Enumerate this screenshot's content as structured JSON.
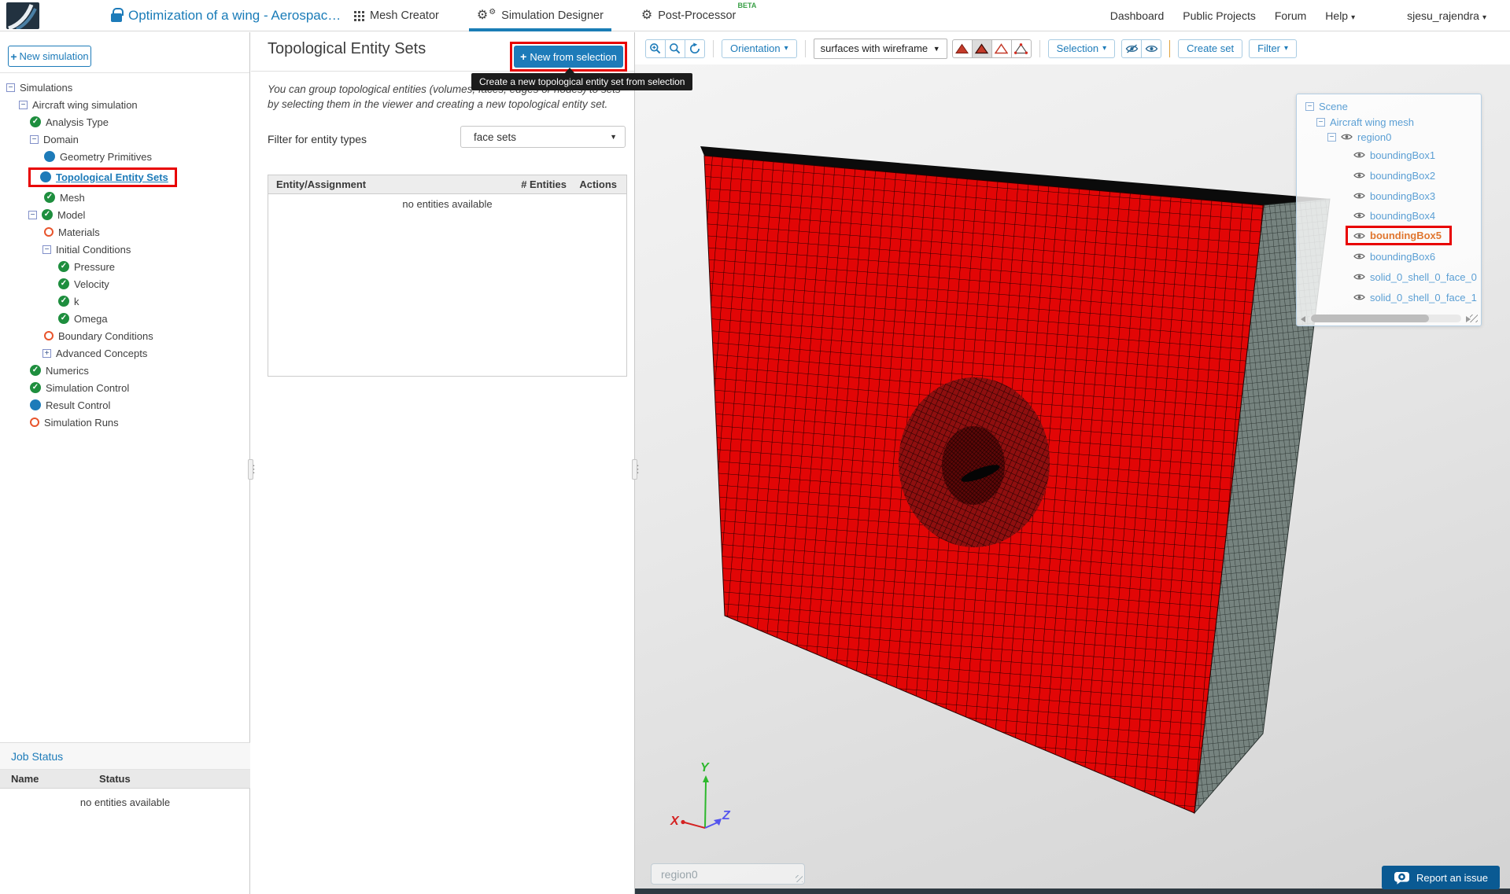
{
  "topbar": {
    "title": "Optimization of a wing - Aerospac…",
    "tabs": [
      {
        "label": "Mesh Creator"
      },
      {
        "label": "Simulation Designer"
      },
      {
        "label": "Post-Processor",
        "badge": "BETA"
      }
    ],
    "nav": [
      "Dashboard",
      "Public Projects",
      "Forum"
    ],
    "help": "Help",
    "user": "sjesu_rajendra"
  },
  "sidebar": {
    "new_simulation": "New simulation",
    "tree": [
      {
        "label": "Simulations"
      },
      {
        "label": "Aircraft wing simulation"
      },
      {
        "label": "Analysis Type"
      },
      {
        "label": "Domain"
      },
      {
        "label": "Geometry Primitives"
      },
      {
        "label": "Topological Entity Sets"
      },
      {
        "label": "Mesh"
      },
      {
        "label": "Model"
      },
      {
        "label": "Materials"
      },
      {
        "label": "Initial Conditions"
      },
      {
        "label": "Pressure"
      },
      {
        "label": "Velocity"
      },
      {
        "label": "k"
      },
      {
        "label": "Omega"
      },
      {
        "label": "Boundary Conditions"
      },
      {
        "label": "Advanced Concepts"
      },
      {
        "label": "Numerics"
      },
      {
        "label": "Simulation Control"
      },
      {
        "label": "Result Control"
      },
      {
        "label": "Simulation Runs"
      }
    ],
    "job_status": {
      "title": "Job Status",
      "col_name": "Name",
      "col_status": "Status",
      "empty": "no entities available"
    }
  },
  "panel": {
    "title": "Topological Entity Sets",
    "new_from_selection": "New from selection",
    "tooltip": "Create a new topological entity set from selection",
    "description": "You can group topological entities (volumes, faces, edges or nodes) to sets by selecting them in the viewer and creating a new topological entity set.",
    "filter_label": "Filter for entity types",
    "filter_value": "face sets",
    "table": {
      "col_entity": "Entity/Assignment",
      "col_count": "# Entities",
      "col_actions": "Actions",
      "empty": "no entities available"
    }
  },
  "viewer": {
    "toolbar": {
      "orientation": "Orientation",
      "render_mode": "surfaces with wireframe",
      "selection": "Selection",
      "create_set": "Create set",
      "filter": "Filter"
    },
    "scene": [
      "Scene",
      "Aircraft wing mesh",
      "region0",
      "boundingBox1",
      "boundingBox2",
      "boundingBox3",
      "boundingBox4",
      "boundingBox5",
      "boundingBox6",
      "solid_0_shell_0_face_0",
      "solid_0_shell_0_face_1"
    ],
    "region_label": "region0",
    "axes": {
      "x": "X",
      "y": "Y",
      "z": "Z"
    },
    "report": "Report an issue"
  },
  "colors": {
    "accent": "#1d7bb9",
    "highlight_box": "#e80000",
    "status_done": "#1e8e3e",
    "status_todo": "#e8542c",
    "mesh_red": "#e20606",
    "beta_green": "#3aa047"
  }
}
